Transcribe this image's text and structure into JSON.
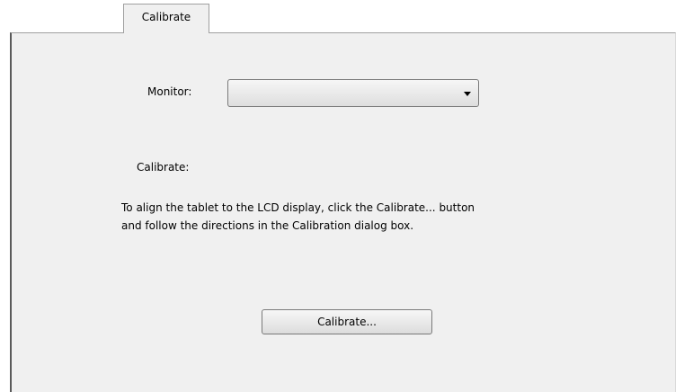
{
  "tabs": [
    {
      "label": "Calibrate",
      "selected": true
    }
  ],
  "monitor": {
    "label": "Monitor:",
    "value": ""
  },
  "calibrate": {
    "label": "Calibrate:",
    "description_lines": [
      "To align the tablet to the LCD display, click the Calibrate... button",
      "and follow the directions in the Calibration dialog box."
    ],
    "button_label": "Calibrate..."
  }
}
